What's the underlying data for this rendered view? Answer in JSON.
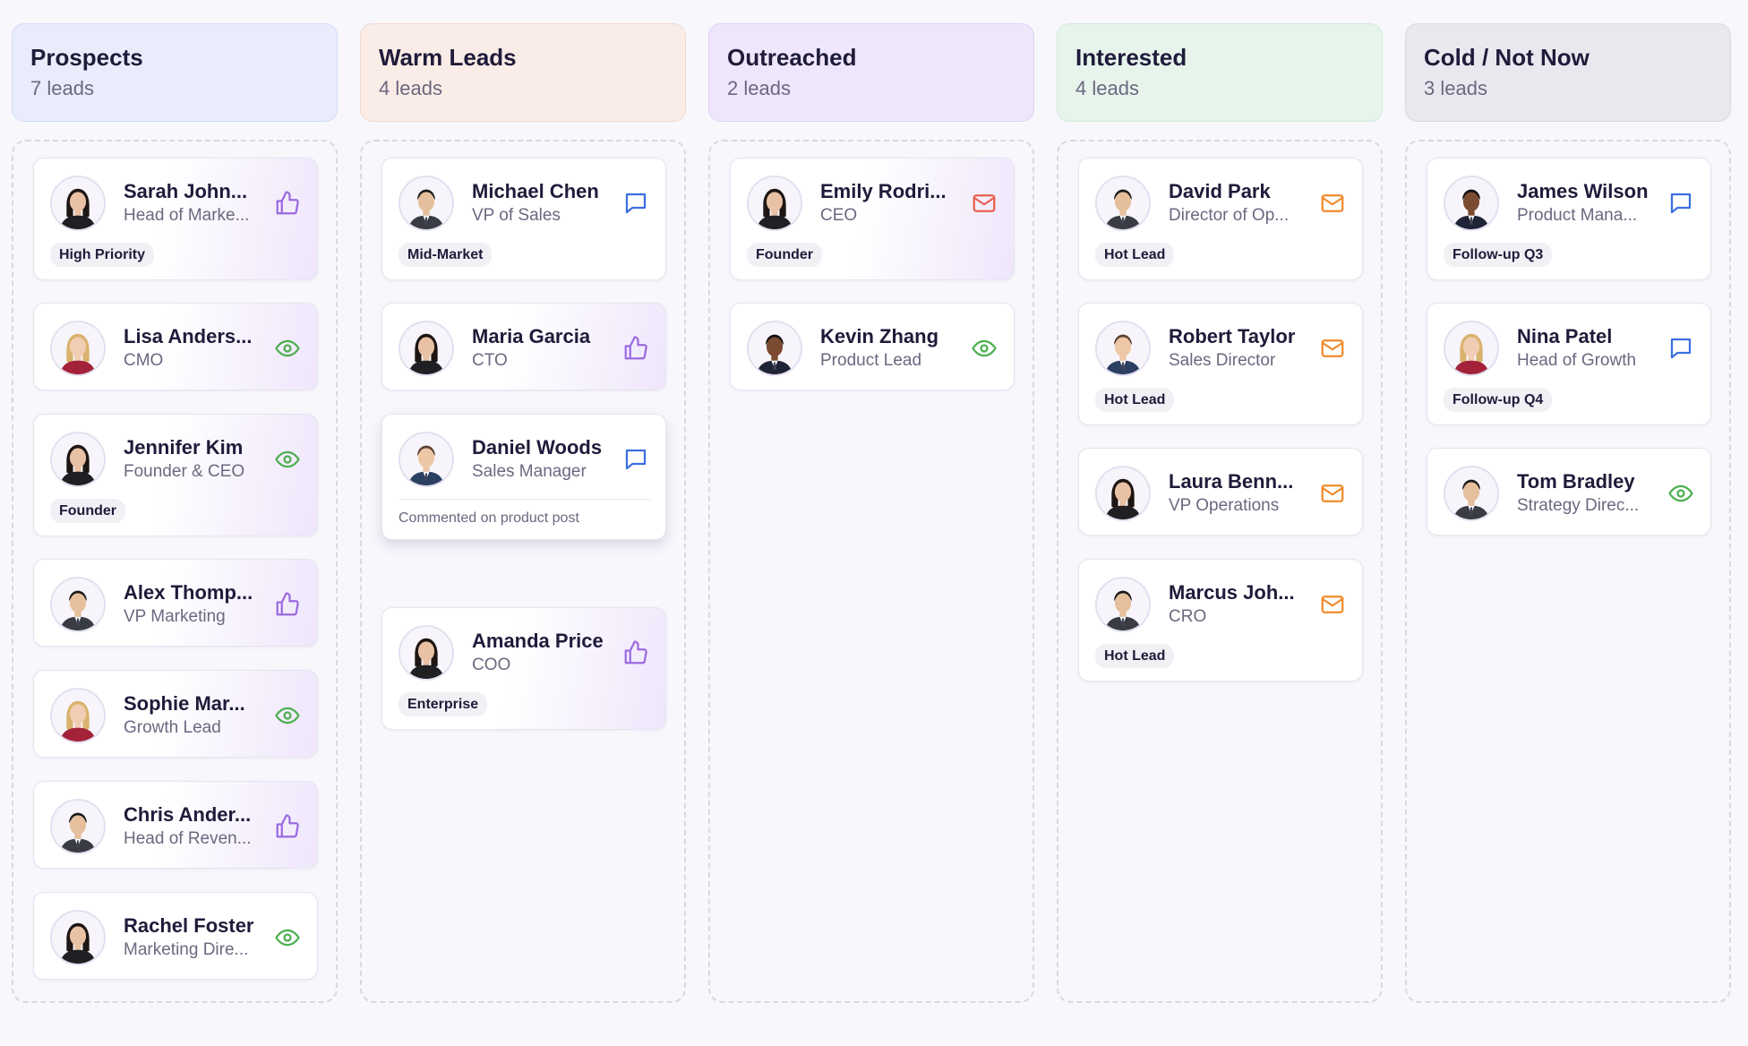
{
  "columns": [
    {
      "title": "Prospects",
      "count": "7 leads",
      "header_bg": "#e9edfb",
      "header_border": "#d4dcf5",
      "cards": [
        {
          "name": "Sarah John...",
          "role": "Head of Marke...",
          "tag": "High Priority",
          "icon": "thumbs-up-icon",
          "icon_color": "#9b6be0",
          "avatar": "woman-dark-hair"
        },
        {
          "name": "Lisa Anders...",
          "role": "CMO",
          "icon": "eye-icon",
          "icon_color": "#4caf50",
          "avatar": "woman-blonde"
        },
        {
          "name": "Jennifer Kim",
          "role": "Founder & CEO",
          "tag": "Founder",
          "icon": "eye-icon",
          "icon_color": "#4caf50",
          "avatar": "woman-dark-hair"
        },
        {
          "name": "Alex Thomp...",
          "role": "VP Marketing",
          "icon": "thumbs-up-icon",
          "icon_color": "#9b6be0",
          "avatar": "man-suit"
        },
        {
          "name": "Sophie Mar...",
          "role": "Growth Lead",
          "icon": "eye-icon",
          "icon_color": "#4caf50",
          "avatar": "woman-blonde"
        },
        {
          "name": "Chris Ander...",
          "role": "Head of Reven...",
          "icon": "thumbs-up-icon",
          "icon_color": "#9b6be0",
          "avatar": "man-suit"
        },
        {
          "name": "Rachel Foster",
          "role": "Marketing Dire...",
          "icon": "eye-icon",
          "icon_color": "#4caf50",
          "avatar": "woman-dark-hair"
        }
      ]
    },
    {
      "title": "Warm Leads",
      "count": "4 leads",
      "header_bg": "#faece6",
      "header_border": "#f2d9cf",
      "cards": [
        {
          "name": "Michael Chen",
          "role": "VP of Sales",
          "tag": "Mid-Market",
          "icon": "comment-icon",
          "icon_color": "#3b6fe0",
          "avatar": "man-suit"
        },
        {
          "name": "Maria Garcia",
          "role": "CTO",
          "icon": "thumbs-up-icon",
          "icon_color": "#9b6be0",
          "avatar": "woman-dark-hair"
        },
        {
          "name": "Daniel Woods",
          "role": "Sales Manager",
          "note": "Commented on product post",
          "icon": "comment-icon",
          "icon_color": "#3b6fe0",
          "avatar": "man-suit-blue"
        },
        {
          "name": "Amanda Price",
          "role": "COO",
          "tag": "Enterprise",
          "icon": "thumbs-up-icon",
          "icon_color": "#9b6be0",
          "avatar": "woman-dark-hair"
        }
      ]
    },
    {
      "title": "Outreached",
      "count": "2 leads",
      "header_bg": "#efe6fb",
      "header_border": "#e0d2f5",
      "cards": [
        {
          "name": "Emily Rodri...",
          "role": "CEO",
          "tag": "Founder",
          "icon": "mail-icon",
          "icon_color": "#e8604c",
          "avatar": "woman-dark-hair"
        },
        {
          "name": "Kevin Zhang",
          "role": "Product Lead",
          "icon": "eye-icon",
          "icon_color": "#4caf50",
          "avatar": "man-dark-skin"
        }
      ]
    },
    {
      "title": "Interested",
      "count": "4 leads",
      "header_bg": "#e7f4ec",
      "header_border": "#d3eadb",
      "cards": [
        {
          "name": "David Park",
          "role": "Director of Op...",
          "tag": "Hot Lead",
          "icon": "mail-icon",
          "icon_color": "#f08a2c",
          "avatar": "man-suit"
        },
        {
          "name": "Robert Taylor",
          "role": "Sales Director",
          "tag": "Hot Lead",
          "icon": "mail-icon",
          "icon_color": "#f08a2c",
          "avatar": "man-suit-blue"
        },
        {
          "name": "Laura Benn...",
          "role": "VP Operations",
          "icon": "mail-icon",
          "icon_color": "#f08a2c",
          "avatar": "woman-dark-hair"
        },
        {
          "name": "Marcus Joh...",
          "role": "CRO",
          "tag": "Hot Lead",
          "icon": "mail-icon",
          "icon_color": "#f08a2c",
          "avatar": "man-suit"
        }
      ]
    },
    {
      "title": "Cold / Not Now",
      "count": "3 leads",
      "header_bg": "#e8e9ef",
      "header_border": "#d8d9e2",
      "cards": [
        {
          "name": "James Wilson",
          "role": "Product Mana...",
          "tag": "Follow-up Q3",
          "icon": "comment-icon",
          "icon_color": "#3b6fe0",
          "avatar": "man-dark-skin"
        },
        {
          "name": "Nina Patel",
          "role": "Head of Growth",
          "tag": "Follow-up Q4",
          "icon": "comment-icon",
          "icon_color": "#3b6fe0",
          "avatar": "woman-blonde"
        },
        {
          "name": "Tom Bradley",
          "role": "Strategy Direc...",
          "icon": "eye-icon",
          "icon_color": "#4caf50",
          "avatar": "man-suit"
        }
      ]
    }
  ]
}
